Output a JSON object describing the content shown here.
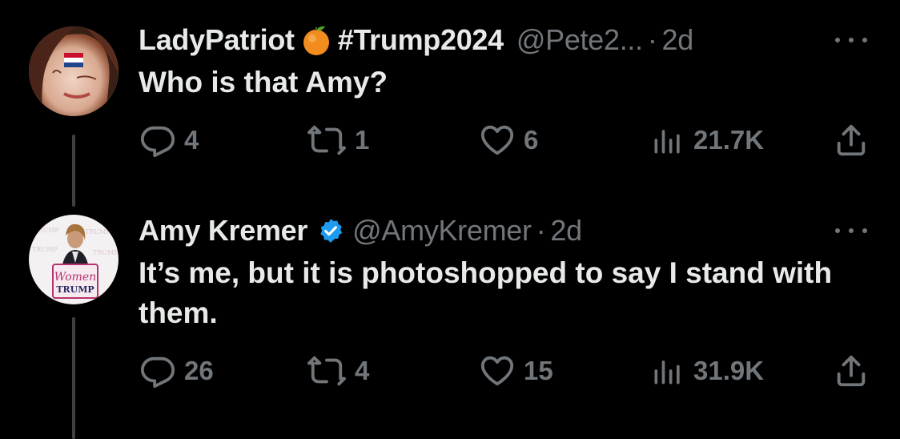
{
  "colors": {
    "background": "#000000",
    "text": "#e7e9ea",
    "secondary": "#71767b",
    "verified_badge": "#1d9bf0",
    "thread_line": "#3e4144"
  },
  "tweets": [
    {
      "author": {
        "name": "LadyPatriot",
        "name_emoji": "orange-emoji",
        "hashtag": "#Trump2024",
        "handle": "@Pete2...",
        "separator": "·",
        "time": "2d",
        "verified": false
      },
      "text": "Who is that Amy?",
      "stats": {
        "replies": "4",
        "retweets": "1",
        "likes": "6",
        "views": "21.7K"
      }
    },
    {
      "author": {
        "name": "Amy Kremer",
        "handle": "@AmyKremer",
        "separator": "·",
        "time": "2d",
        "verified": true
      },
      "avatar_text": {
        "line1": "Women",
        "line2": "TRUMP"
      },
      "text": "It’s me, but it is photoshopped to say I stand with them.",
      "stats": {
        "replies": "26",
        "retweets": "4",
        "likes": "15",
        "views": "31.9K"
      }
    }
  ]
}
